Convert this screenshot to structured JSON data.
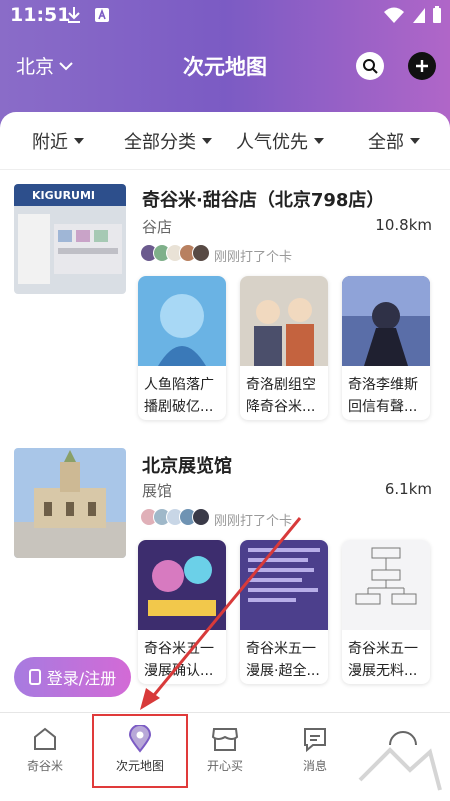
{
  "status_bar": {
    "time": "11:51"
  },
  "header": {
    "city": "北京",
    "title": "次元地图"
  },
  "filters": [
    "附近",
    "全部分类",
    "人气优先",
    "全部"
  ],
  "places": [
    {
      "name": "奇谷米·甜谷店（北京798店）",
      "category": "谷店",
      "distance": "10.8km",
      "checkin": "刚刚打了个卡",
      "thumb_sign": "KIGURUMI",
      "posts": [
        "人鱼陷落广播剧破亿...",
        "奇洛剧组空降奇谷米...",
        "奇洛李维斯回信有聲..."
      ]
    },
    {
      "name": "北京展览馆",
      "category": "展馆",
      "distance": "6.1km",
      "checkin": "刚刚打了个卡",
      "posts": [
        "奇谷米五一漫展确认...",
        "奇谷米五一漫展·超全...",
        "奇谷米五一漫展无料..."
      ]
    }
  ],
  "login_button": "登录/注册",
  "bottom_nav": [
    "奇谷米",
    "次元地图",
    "开心买",
    "消息"
  ],
  "colors": {
    "accent": "#7b5bc4",
    "highlight": "#e03a3a"
  }
}
